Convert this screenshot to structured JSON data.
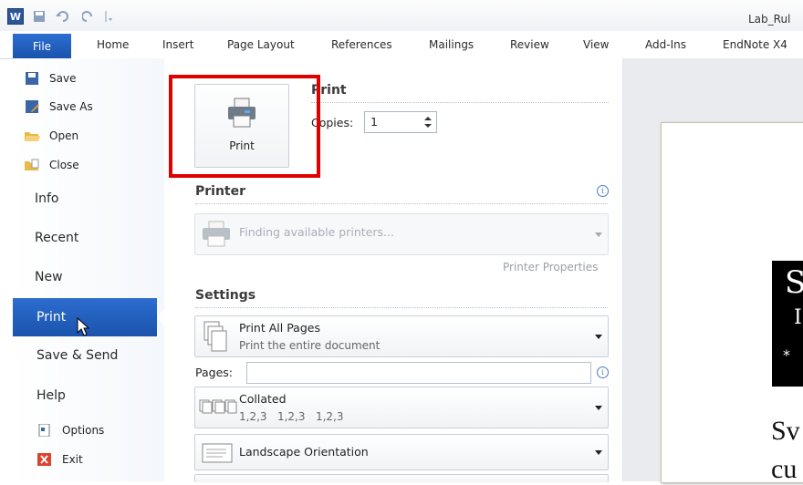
{
  "window": {
    "title": "Lab_Rul"
  },
  "ribbon": {
    "file_tab": "File",
    "tabs": [
      "Home",
      "Insert",
      "Page Layout",
      "References",
      "Mailings",
      "Review",
      "View",
      "Add-Ins",
      "EndNote X4"
    ]
  },
  "nav": {
    "save": "Save",
    "save_as": "Save As",
    "open": "Open",
    "close": "Close",
    "info": "Info",
    "recent": "Recent",
    "new": "New",
    "print": "Print",
    "save_send": "Save & Send",
    "help": "Help",
    "options": "Options",
    "exit": "Exit"
  },
  "print_panel": {
    "print_button": "Print",
    "heading": "Print",
    "copies_label": "Copies:",
    "copies_value": "1",
    "printer_heading": "Printer",
    "printer_value": "Finding available printers...",
    "printer_properties": "Printer Properties",
    "settings_heading": "Settings",
    "pages_setting_title": "Print All Pages",
    "pages_setting_sub": "Print the entire document",
    "pages_label": "Pages:",
    "pages_value": "",
    "collated_title": "Collated",
    "collated_sub": "1,2,3   1,2,3   1,2,3",
    "orientation": "Landscape Orientation"
  },
  "preview": {
    "black_text": "S",
    "black_text2": "I",
    "star": "*",
    "body1": "Sv",
    "body2": "cu"
  },
  "colors": {
    "file_blue": "#1a52ad",
    "highlight_red": "#e00000"
  }
}
